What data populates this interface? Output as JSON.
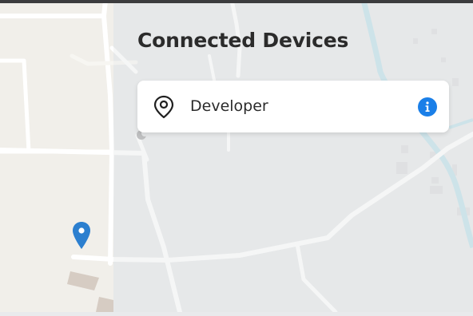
{
  "panel": {
    "title": "Connected Devices",
    "devices": [
      {
        "label": "Developer",
        "icon": "map-pin-outline-icon",
        "action_icon": "info-icon"
      }
    ]
  },
  "map": {
    "marker_icon": "map-marker-icon",
    "marker_color": "#2c7fcf",
    "land_color": "#f1efea",
    "overlay_color": "#e9eaec",
    "road_color": "#ffffff",
    "water_color": "#b7dde7"
  },
  "colors": {
    "info_accent": "#1a7fe8",
    "title_text": "#2b2b2b",
    "card_bg": "#ffffff"
  }
}
